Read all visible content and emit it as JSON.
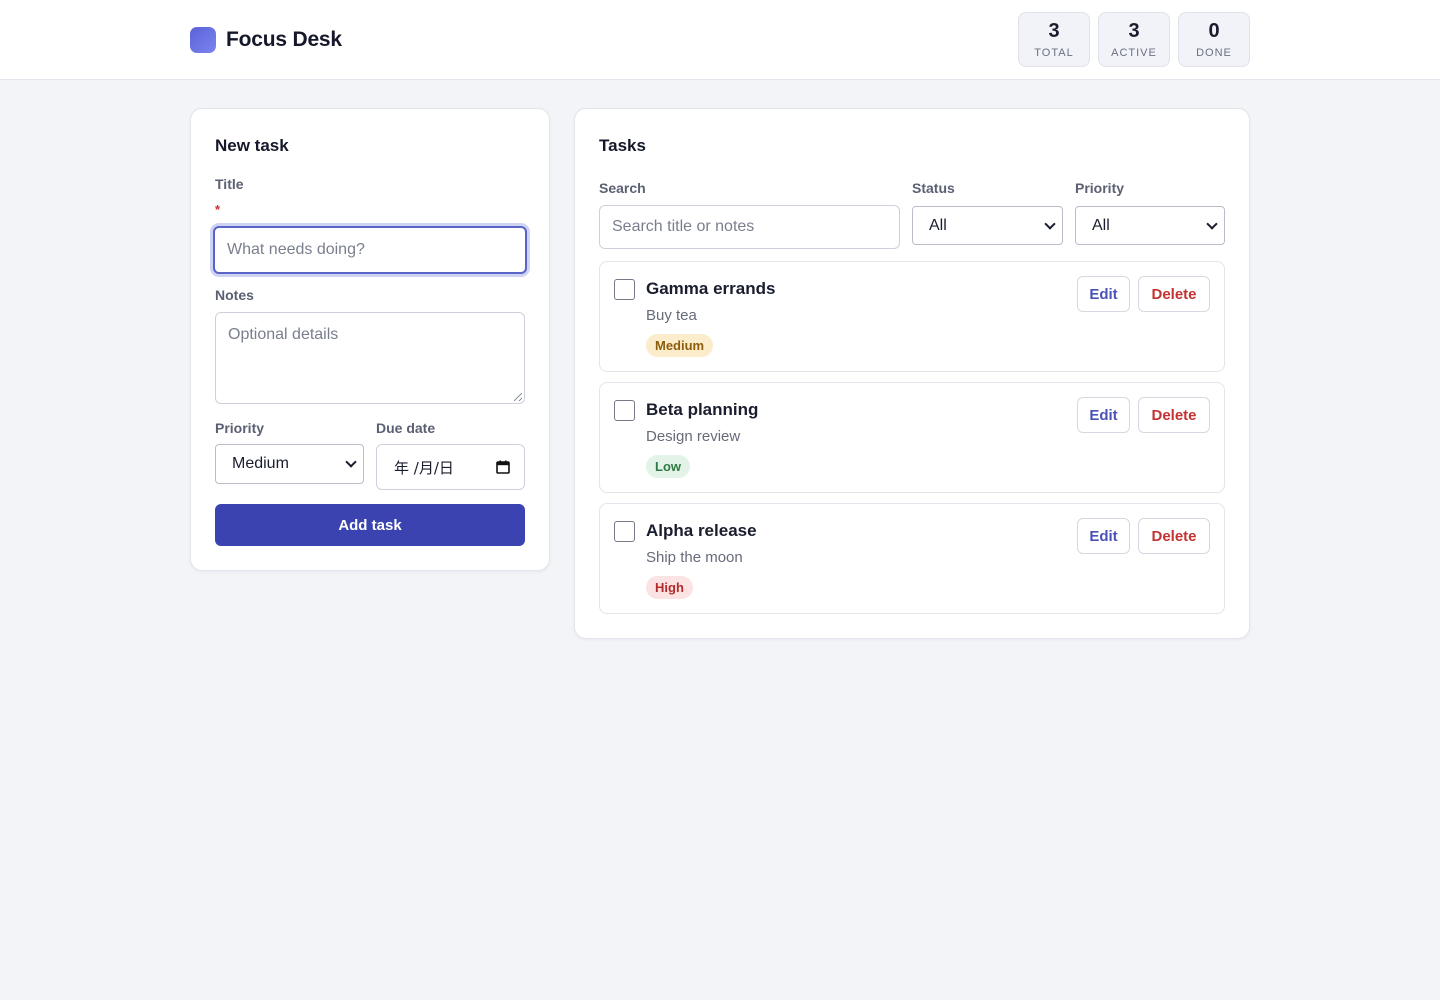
{
  "app": {
    "title": "Focus Desk"
  },
  "stats": [
    {
      "value": "3",
      "label": "TOTAL"
    },
    {
      "value": "3",
      "label": "ACTIVE"
    },
    {
      "value": "0",
      "label": "DONE"
    }
  ],
  "new_task": {
    "heading": "New task",
    "title_label": "Title",
    "required_mark": "*",
    "title_placeholder": "What needs doing?",
    "notes_label": "Notes",
    "notes_placeholder": "Optional details",
    "priority_label": "Priority",
    "priority_value": "Medium",
    "due_label": "Due date",
    "due_value": "年 /月/日",
    "add_label": "Add task"
  },
  "tasks_panel": {
    "heading": "Tasks",
    "search_label": "Search",
    "search_placeholder": "Search title or notes",
    "status_label": "Status",
    "status_value": "All",
    "priority_label": "Priority",
    "priority_value": "All"
  },
  "tasks": [
    {
      "title": "Gamma errands",
      "notes": "Buy tea",
      "priority": "Medium",
      "done": false,
      "edit_label": "Edit",
      "delete_label": "Delete"
    },
    {
      "title": "Beta planning",
      "notes": "Design review",
      "priority": "Low",
      "done": false,
      "edit_label": "Edit",
      "delete_label": "Delete"
    },
    {
      "title": "Alpha release",
      "notes": "Ship the moon",
      "priority": "High",
      "done": false,
      "edit_label": "Edit",
      "delete_label": "Delete"
    }
  ],
  "colors": {
    "accent": "#3a43b0",
    "background": "#f3f4f8",
    "danger": "#c43232",
    "badge_medium": "#fbeccb",
    "badge_low": "#e3f3e7",
    "badge_high": "#fbe3e3"
  },
  "icons": {
    "logo": "app-logo",
    "date": "calendar-icon",
    "select": "chevron-down-icon"
  }
}
